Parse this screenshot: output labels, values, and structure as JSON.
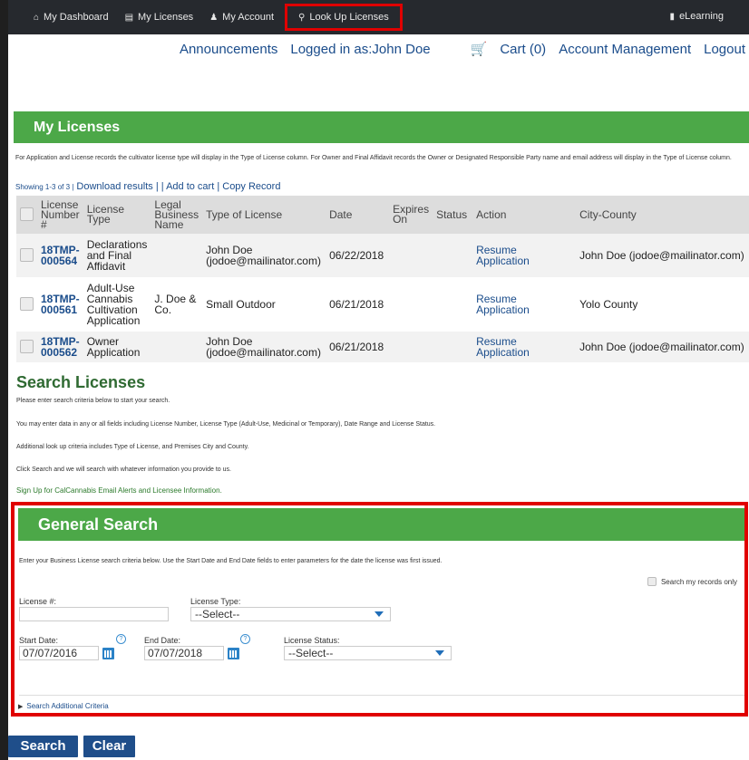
{
  "topnav": {
    "dashboard": "My Dashboard",
    "licenses": "My Licenses",
    "account": "My Account",
    "lookup": "Look Up Licenses",
    "elearning": "eLearning"
  },
  "util": {
    "announcements": "Announcements",
    "logged_in": "Logged in as:John Doe",
    "cart": "Cart (0)",
    "account_mgmt": "Account Management",
    "logout": "Logout"
  },
  "my_licenses": {
    "title": "My Licenses",
    "note": "For Application and License records the cultivator license type will display in the Type of License column.  For Owner and Final Affidavit records the Owner or Designated Responsible Party name and email address will display in the Type of License column.",
    "showing": "Showing 1-3 of 3 |",
    "download": "Download results |",
    "add_cart": "| Add to cart |",
    "copy": "Copy Record",
    "columns": [
      "License Number #",
      "License Type",
      "Legal Business Name",
      "Type of License",
      "Date",
      "Expires On",
      "Status",
      "Action",
      "City-County"
    ],
    "rows": [
      {
        "number": "18TMP-000564",
        "type": "Declarations and Final Affidavit",
        "business": "",
        "license_type": "John Doe (jodoe@mailinator.com)",
        "date": "06/22/2018",
        "expires": "",
        "status": "",
        "action": "Resume Application",
        "city": "John Doe (jodoe@mailinator.com)"
      },
      {
        "number": "18TMP-000561",
        "type": "Adult-Use Cannabis Cultivation Application",
        "business": "J. Doe & Co.",
        "license_type": "Small Outdoor",
        "date": "06/21/2018",
        "expires": "",
        "status": "",
        "action": "Resume Application",
        "city": "Yolo County"
      },
      {
        "number": "18TMP-000562",
        "type": "Owner Application",
        "business": "",
        "license_type": "John Doe (jodoe@mailinator.com)",
        "date": "06/21/2018",
        "expires": "",
        "status": "",
        "action": "Resume Application",
        "city": "John Doe (jodoe@mailinator.com)"
      }
    ]
  },
  "search": {
    "title": "Search Licenses",
    "line1": "Please enter search criteria below to start your search.",
    "line2": "You may enter data in any or all fields including License Number, License Type (Adult-Use, Medicinal or Temporary), Date Range and License Status.",
    "line3": "Additional look up criteria includes Type of License, and Premises City and County.",
    "line4": "Click Search and we will search with whatever information you provide to us.",
    "signup": "Sign Up for CalCannabis Email Alerts and Licensee Information."
  },
  "general": {
    "title": "General Search",
    "desc": "Enter your Business License search criteria below.  Use the Start Date and End Date fields to enter parameters for the date the license was first issued.",
    "my_records": "Search my records only",
    "license_no_label": "License #:",
    "license_no_value": "",
    "license_type_label": "License Type:",
    "license_type_value": "--Select--",
    "start_label": "Start Date:",
    "start_value": "07/07/2016",
    "end_label": "End Date:",
    "end_value": "07/07/2018",
    "status_label": "License Status:",
    "status_value": "--Select--",
    "additional": "Search Additional Criteria"
  },
  "buttons": {
    "search": "Search",
    "clear": "Clear"
  }
}
